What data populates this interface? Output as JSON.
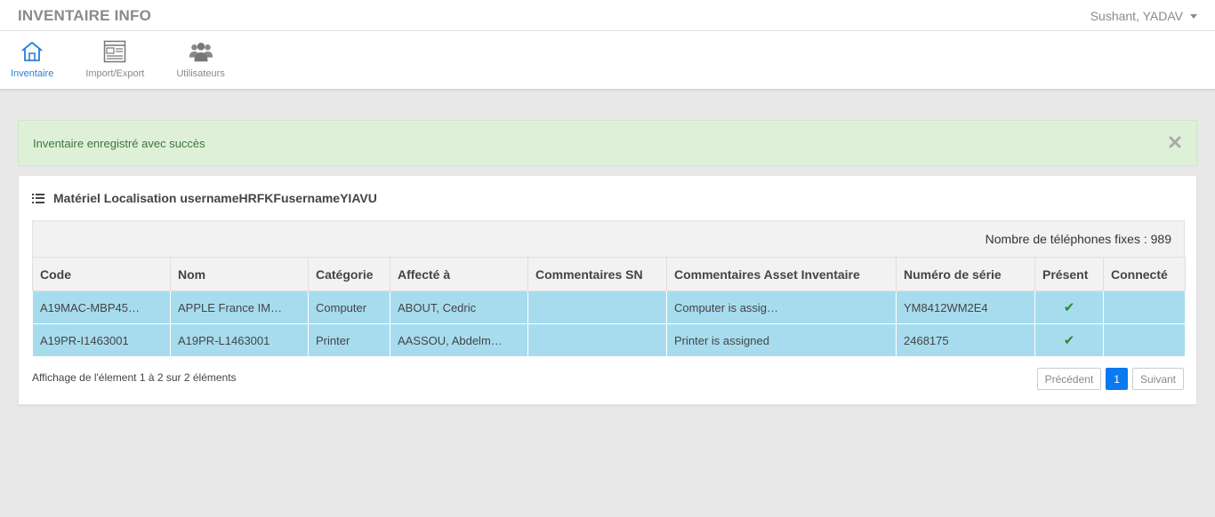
{
  "app": {
    "title": "INVENTAIRE INFO",
    "user": "Sushant, YADAV"
  },
  "nav": {
    "items": [
      {
        "label": "Inventaire",
        "icon": "home-icon",
        "active": true
      },
      {
        "label": "Import/Export",
        "icon": "import-export-icon",
        "active": false
      },
      {
        "label": "Utilisateurs",
        "icon": "users-icon",
        "active": false
      }
    ]
  },
  "alert": {
    "message": "Inventaire enregistré avec succès"
  },
  "panel": {
    "title": "Matériel Localisation usernameHRFKFusernameYIAVU",
    "count_text": "Nombre de téléphones fixes : 989"
  },
  "table": {
    "columns": [
      "Code",
      "Nom",
      "Catégorie",
      "Affecté à",
      "Commentaires SN",
      "Commentaires Asset Inventaire",
      "Numéro de série",
      "Présent",
      "Connecté"
    ],
    "rows": [
      {
        "code": "A19MAC-MBP45…",
        "nom": "APPLE France IM…",
        "categorie": "Computer",
        "affecte": "ABOUT, Cedric",
        "comm_sn": "",
        "comm_asset": "Computer is assig…",
        "serie": "YM8412WM2E4",
        "present": "✔",
        "connecte": ""
      },
      {
        "code": "A19PR-I1463001",
        "nom": "A19PR-L1463001",
        "categorie": "Printer",
        "affecte": "AASSOU, Abdelm…",
        "comm_sn": "",
        "comm_asset": "Printer is assigned",
        "serie": "2468175",
        "present": "✔",
        "connecte": ""
      }
    ]
  },
  "footer": {
    "info": "Affichage de l'élement 1 à 2 sur 2 éléments",
    "prev": "Précédent",
    "page": "1",
    "next": "Suivant"
  },
  "colors": {
    "accent": "#0b79f0",
    "row_selected": "#a7dcef",
    "alert_bg": "#dff0d8",
    "check": "#2d8a2d"
  }
}
